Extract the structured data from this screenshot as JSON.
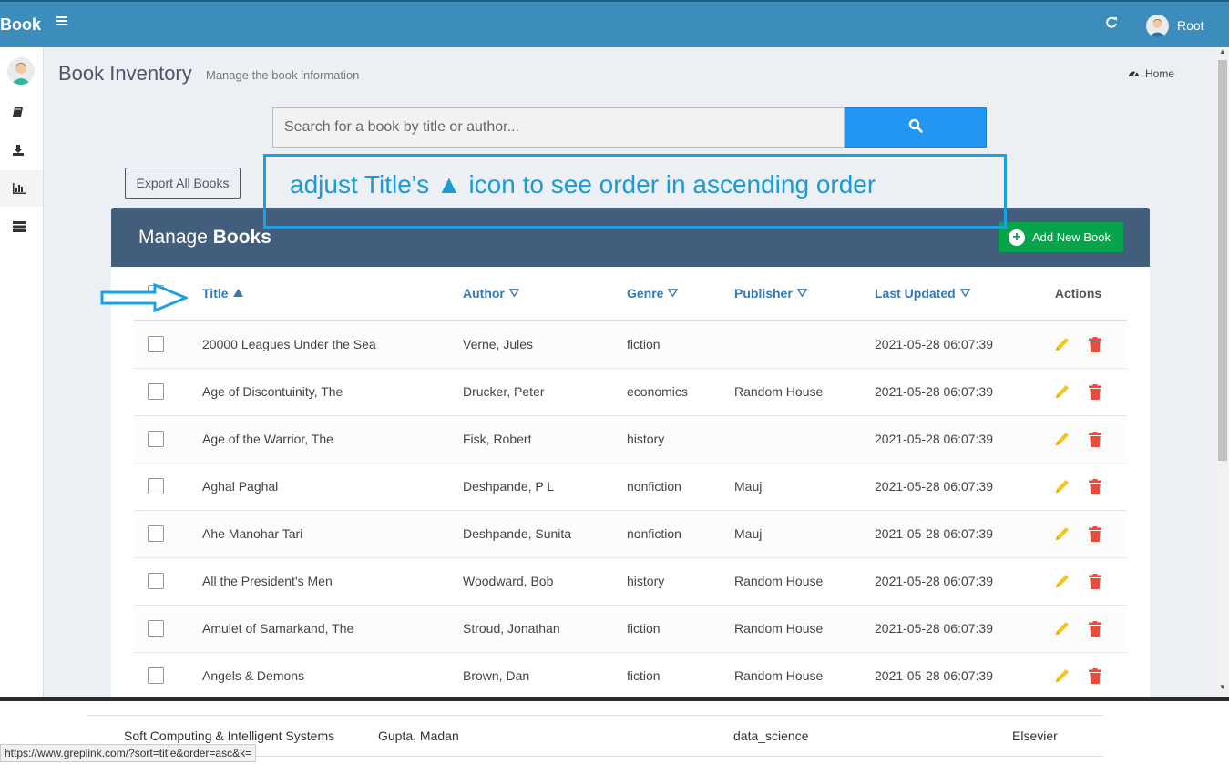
{
  "topbar": {
    "brand": "Book",
    "menu_icon": "hamburger-icon",
    "refresh_icon": "refresh-icon",
    "user_name": "Root"
  },
  "sidebar": {
    "items": [
      {
        "icon": "book-icon"
      },
      {
        "icon": "download-icon"
      },
      {
        "icon": "bar-chart-icon"
      },
      {
        "icon": "list-icon"
      }
    ]
  },
  "page": {
    "title": "Book Inventory",
    "subtitle": "Manage the book information",
    "home_label": "Home"
  },
  "search": {
    "placeholder": "Search for a book by title or author...",
    "value": ""
  },
  "export_label": "Export All Books",
  "annotation": {
    "text": "adjust Title's ▲ icon to see order in ascending order"
  },
  "panel": {
    "title_prefix": "Manage ",
    "title_bold": "Books",
    "add_label": "Add New Book"
  },
  "table": {
    "headers": {
      "title": "Title",
      "author": "Author",
      "genre": "Genre",
      "publisher": "Publisher",
      "updated": "Last Updated",
      "actions": "Actions"
    },
    "sort": {
      "column": "title",
      "order": "asc"
    },
    "rows": [
      {
        "title": "20000 Leagues Under the Sea",
        "author": "Verne, Jules",
        "genre": "fiction",
        "publisher": "",
        "updated": "2021-05-28 06:07:39"
      },
      {
        "title": "Age of Discontuinity, The",
        "author": "Drucker, Peter",
        "genre": "economics",
        "publisher": "Random House",
        "updated": "2021-05-28 06:07:39"
      },
      {
        "title": "Age of the Warrior, The",
        "author": "Fisk, Robert",
        "genre": "history",
        "publisher": "",
        "updated": "2021-05-28 06:07:39"
      },
      {
        "title": "Aghal Paghal",
        "author": "Deshpande, P L",
        "genre": "nonfiction",
        "publisher": "Mauj",
        "updated": "2021-05-28 06:07:39"
      },
      {
        "title": "Ahe Manohar Tari",
        "author": "Deshpande, Sunita",
        "genre": "nonfiction",
        "publisher": "Mauj",
        "updated": "2021-05-28 06:07:39"
      },
      {
        "title": "All the President's Men",
        "author": "Woodward, Bob",
        "genre": "history",
        "publisher": "Random House",
        "updated": "2021-05-28 06:07:39"
      },
      {
        "title": "Amulet of Samarkand, The",
        "author": "Stroud, Jonathan",
        "genre": "fiction",
        "publisher": "Random House",
        "updated": "2021-05-28 06:07:39"
      },
      {
        "title": "Angels & Demons",
        "author": "Brown, Dan",
        "genre": "fiction",
        "publisher": "Random House",
        "updated": "2021-05-28 06:07:39"
      }
    ]
  },
  "underlay": {
    "title": "Soft Computing & Intelligent Systems",
    "author": "Gupta, Madan",
    "genre": "data_science",
    "publisher": "Elsevier"
  },
  "status_url": "https://www.greplink.com/?sort=title&order=asc&k=",
  "colors": {
    "topbar": "#3c8dbc",
    "panel_header": "#435d7d",
    "search_button": "#2196f3",
    "add_button": "#06a44b",
    "annotation": "#1ba1e2",
    "edit_icon": "#f5c518",
    "delete_icon": "#e74c3c"
  }
}
